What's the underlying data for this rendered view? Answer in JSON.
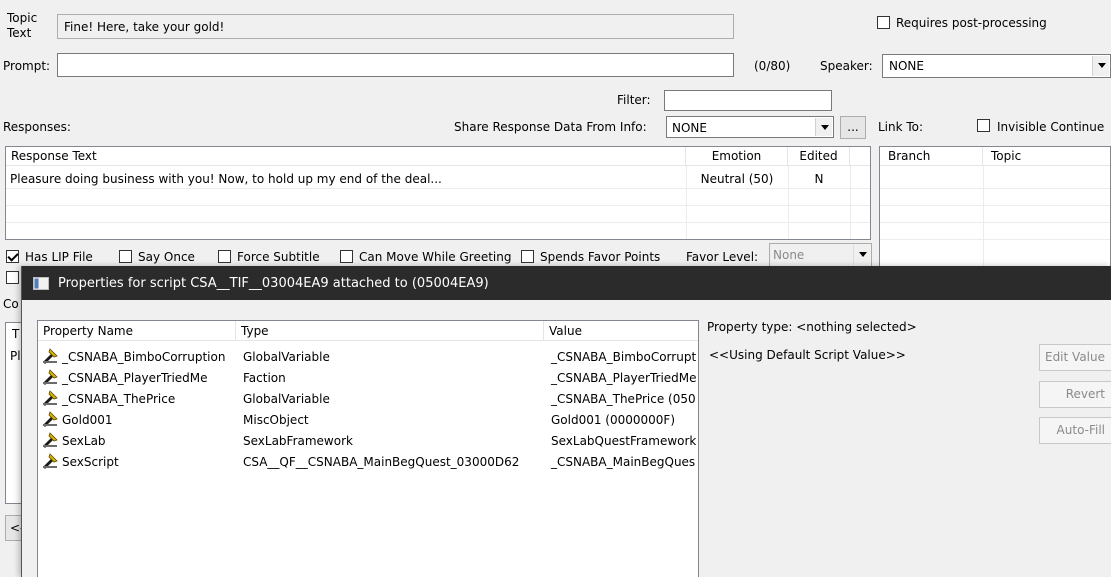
{
  "topic": {
    "label_line1": "Topic",
    "label_line2": "Text",
    "value": "Fine! Here, take your gold!"
  },
  "requires_post_processing": {
    "label": "Requires post-processing",
    "checked": false
  },
  "prompt": {
    "label": "Prompt:",
    "value": "",
    "counter": "(0/80)"
  },
  "speaker": {
    "label": "Speaker:",
    "value": "NONE"
  },
  "filter": {
    "label": "Filter:",
    "value": ""
  },
  "responses": {
    "label": "Responses:",
    "share_label": "Share Response Data From Info:",
    "share_value": "NONE",
    "browse_button": "...",
    "columns": [
      "Response Text",
      "Emotion",
      "Edited"
    ],
    "rows": [
      {
        "text": "Pleasure doing business with you! Now, to hold up my end of the deal...",
        "emotion": "Neutral (50)",
        "edited": "N"
      }
    ]
  },
  "link_to": {
    "label": "Link To:",
    "invisible_continue": {
      "label": "Invisible Continue",
      "checked": false
    },
    "columns": [
      "Branch",
      "Topic"
    ]
  },
  "flags": {
    "has_lip_file": {
      "label": "Has LIP File",
      "checked": true
    },
    "say_once": {
      "label": "Say Once",
      "checked": false
    },
    "force_subtitle": {
      "label": "Force Subtitle",
      "checked": false
    },
    "can_move_while_greeting": {
      "label": "Can Move While Greeting",
      "checked": false
    },
    "spends_favor_points": {
      "label": "Spends Favor Points",
      "checked": false
    },
    "favor_level_label": "Favor Level:",
    "favor_level_value": "None"
  },
  "background_fragments": {
    "row_left": "Co",
    "col_header": "T",
    "cell": "Pl",
    "nav": "<-"
  },
  "dialog": {
    "title": "Properties for script CSA__TIF__03004EA9 attached to  (05004EA9)",
    "columns": [
      "Property Name",
      "Type",
      "Value"
    ],
    "properties": [
      {
        "name": "_CSNABA_BimboCorruption",
        "type": "GlobalVariable",
        "value": "_CSNABA_BimboCorrupt"
      },
      {
        "name": "_CSNABA_PlayerTriedMe",
        "type": "Faction",
        "value": "_CSNABA_PlayerTriedMe"
      },
      {
        "name": "_CSNABA_ThePrice",
        "type": "GlobalVariable",
        "value": "_CSNABA_ThePrice (050"
      },
      {
        "name": "Gold001",
        "type": "MiscObject",
        "value": "Gold001 (0000000F)"
      },
      {
        "name": "SexLab",
        "type": "SexLabFramework",
        "value": "SexLabQuestFramework"
      },
      {
        "name": "SexScript",
        "type": "CSA__QF__CSNABA_MainBegQuest_03000D62",
        "value": "_CSNABA_MainBegQues"
      }
    ],
    "property_type_text": "Property type: <nothing selected>",
    "default_value_text": "<<Using Default Script Value>>",
    "buttons": {
      "edit_value": "Edit Value",
      "revert": "Revert",
      "auto_fill": "Auto-Fill"
    }
  },
  "colors": {
    "dialog_titlebar": "#2b2b2b",
    "window_bg": "#f0f0f0",
    "checkbox_border": "#333333"
  }
}
